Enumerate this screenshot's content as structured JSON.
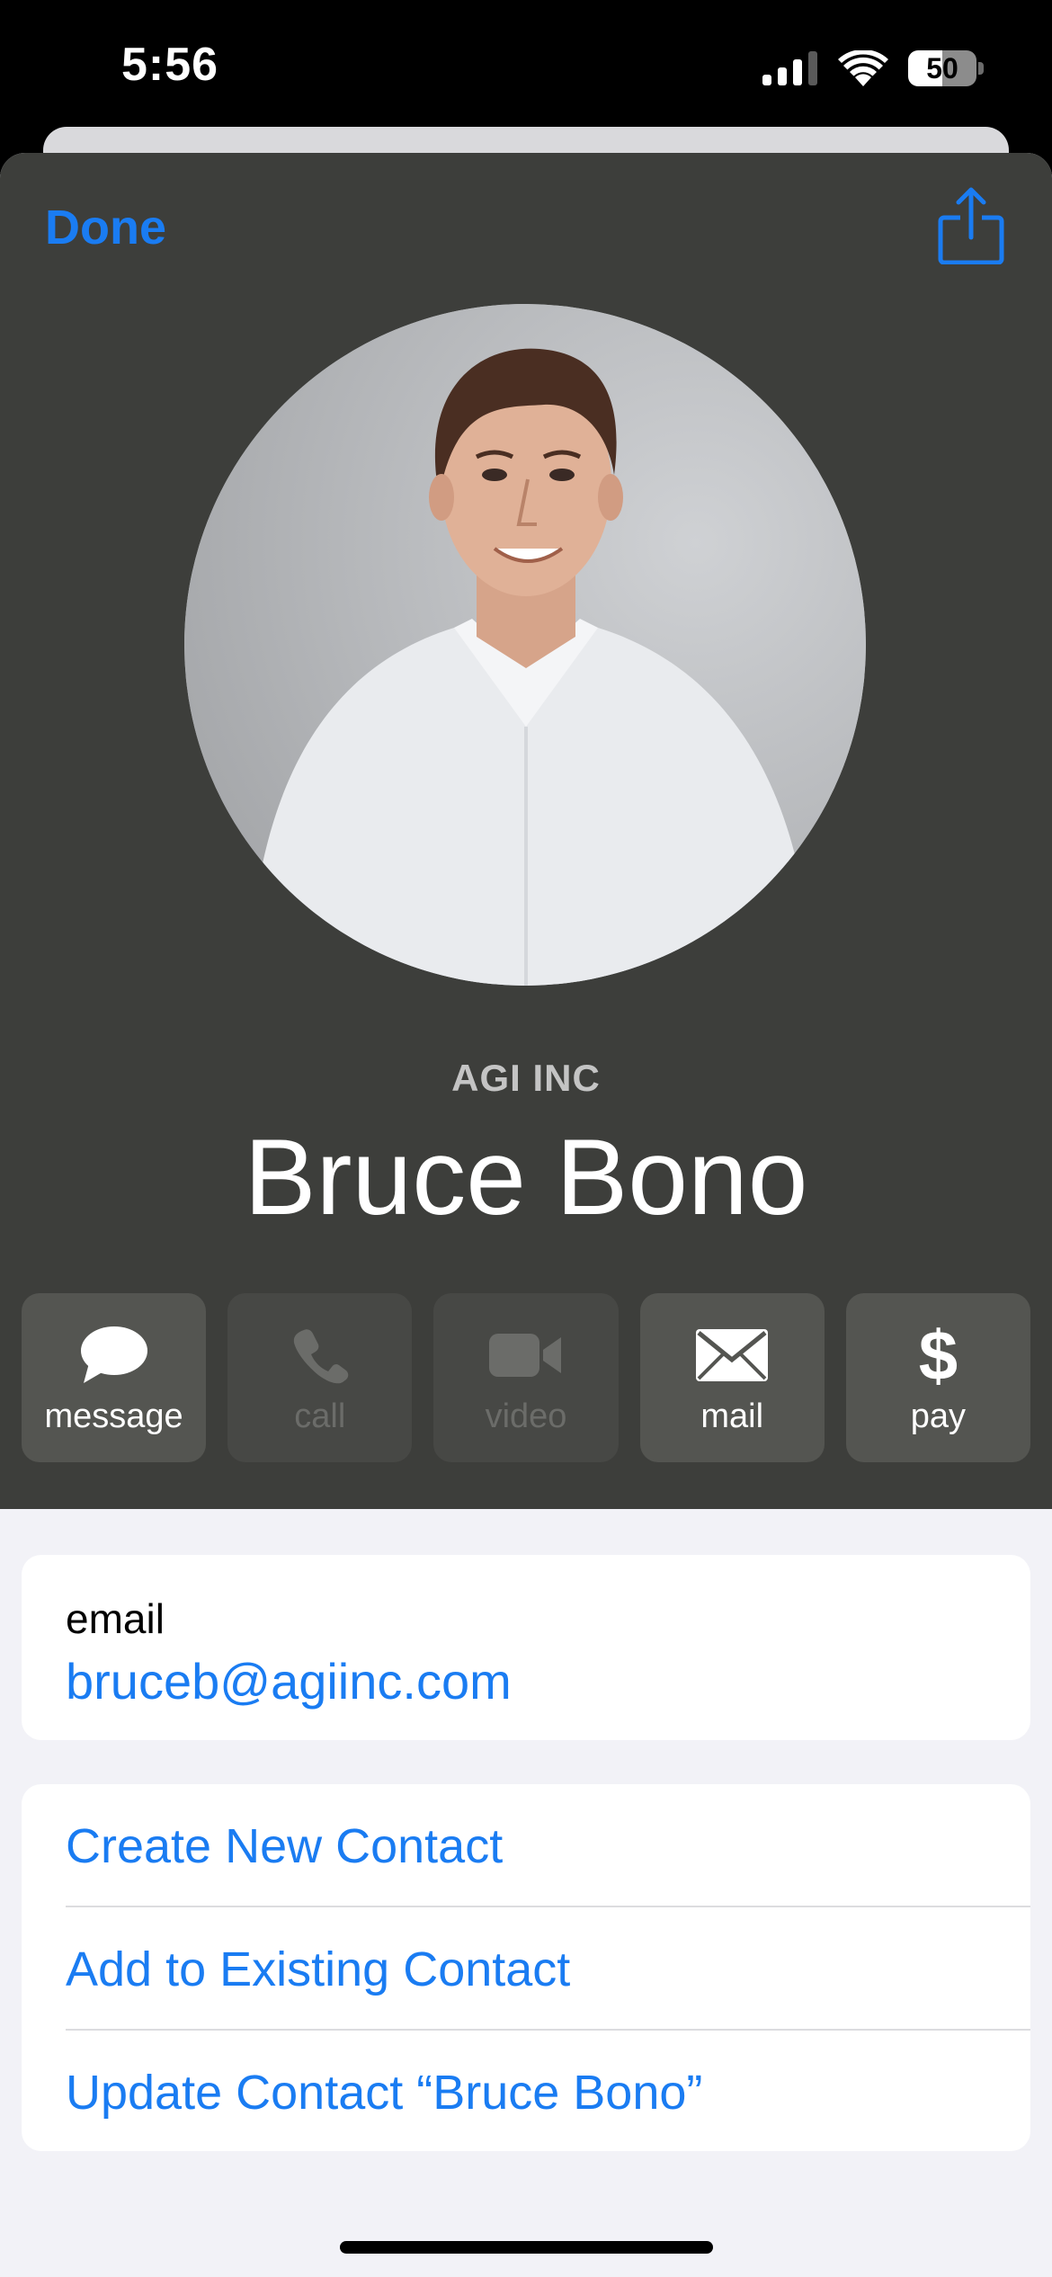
{
  "status_bar": {
    "time": "5:56",
    "battery": "50"
  },
  "header": {
    "done_label": "Done",
    "share_icon": "share-icon",
    "company": "AGI INC",
    "name": "Bruce Bono",
    "background_color": "#3d3e3b",
    "accent_color": "#1a7cf2"
  },
  "actions": [
    {
      "label": "message",
      "icon": "message-bubble-icon",
      "enabled": true
    },
    {
      "label": "call",
      "icon": "phone-icon",
      "enabled": false
    },
    {
      "label": "video",
      "icon": "video-camera-icon",
      "enabled": false
    },
    {
      "label": "mail",
      "icon": "envelope-icon",
      "enabled": true
    },
    {
      "label": "pay",
      "icon": "dollar-icon",
      "enabled": true
    }
  ],
  "email": {
    "label": "email",
    "value": "bruceb@agiinc.com"
  },
  "options": [
    "Create New Contact",
    "Add to Existing Contact",
    "Update Contact “Bruce Bono”"
  ]
}
